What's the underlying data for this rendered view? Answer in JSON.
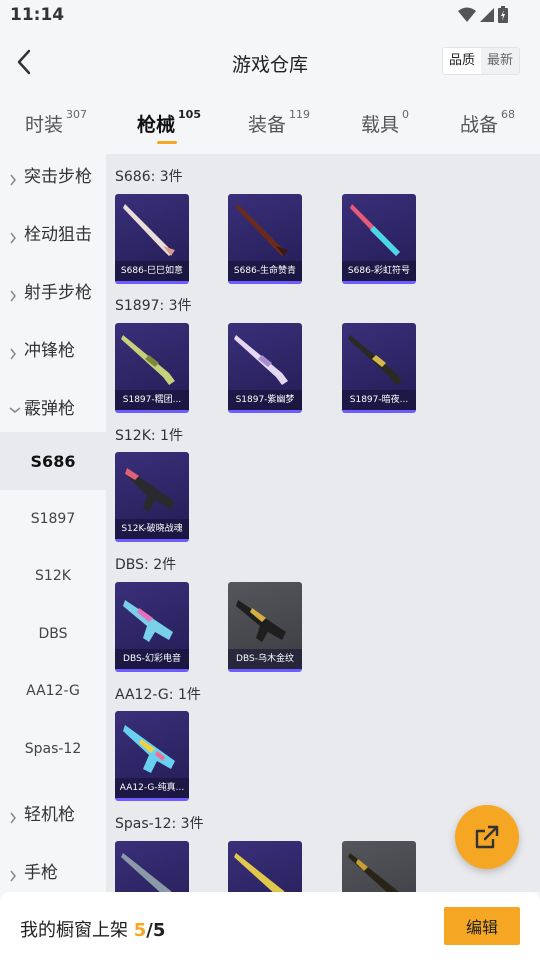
{
  "status": {
    "time": "11:14"
  },
  "header": {
    "title": "游戏仓库",
    "sort_quality": "品质",
    "sort_latest": "最新"
  },
  "tabs": [
    {
      "label": "时装",
      "count": "307"
    },
    {
      "label": "枪械",
      "count": "105"
    },
    {
      "label": "装备",
      "count": "119"
    },
    {
      "label": "载具",
      "count": "0"
    },
    {
      "label": "战备",
      "count": "68"
    }
  ],
  "sidebar": {
    "categories": [
      "突击步枪",
      "栓动狙击",
      "射手步枪",
      "冲锋枪",
      "霰弹枪",
      "轻机枪",
      "手枪"
    ],
    "subs": [
      "S686",
      "S1897",
      "S12K",
      "DBS",
      "AA12-G",
      "Spas-12"
    ]
  },
  "groups": [
    {
      "title": "S686: 3件",
      "items": [
        "S686-巳巳如意",
        "S686-生命赞青",
        "S686-彩虹符号"
      ]
    },
    {
      "title": "S1897: 3件",
      "items": [
        "S1897-糯团...",
        "S1897-紫幽梦",
        "S1897-暗夜..."
      ]
    },
    {
      "title": "S12K: 1件",
      "items": [
        "S12K-破晓战魂"
      ]
    },
    {
      "title": "DBS: 2件",
      "items": [
        "DBS-幻彩电音",
        "DBS-乌木金纹"
      ]
    },
    {
      "title": "AA12-G: 1件",
      "items": [
        "AA12-G-纯真..."
      ]
    },
    {
      "title": "Spas-12: 3件",
      "items": [
        "",
        "",
        ""
      ]
    }
  ],
  "bottom": {
    "shelf_label": "我的橱窗上架",
    "current": "5",
    "total": "/5",
    "edit_label": "编辑"
  },
  "colors": {
    "accent": "#f5a623",
    "item_bg": "#2e2568",
    "item_border": "#6d5cff"
  },
  "icons": {
    "back": "back-arrow-icon",
    "share": "share-icon",
    "expand": "chevron-right-icon",
    "collapse": "chevron-down-icon"
  }
}
